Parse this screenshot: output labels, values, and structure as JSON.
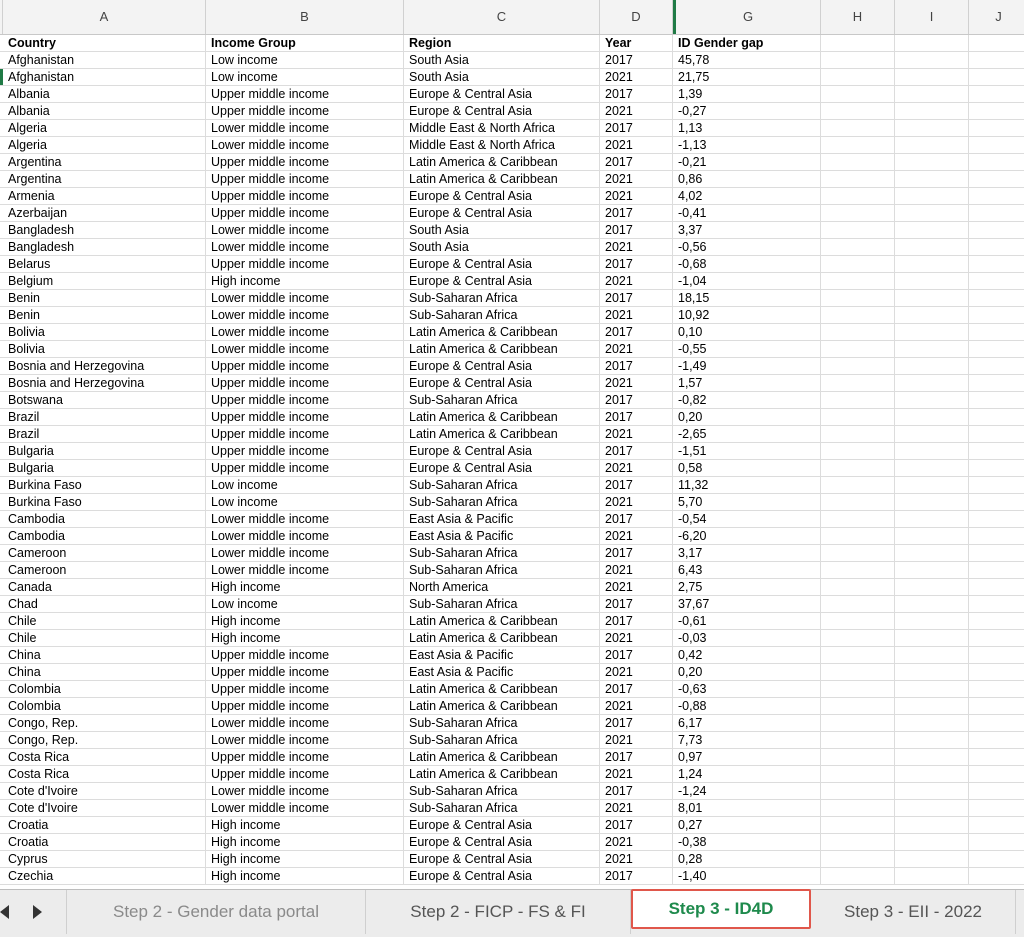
{
  "columns": [
    "A",
    "B",
    "C",
    "D",
    "G",
    "H",
    "I",
    "J"
  ],
  "header": [
    "Country",
    "Income Group",
    "Region",
    "Year",
    "ID Gender gap"
  ],
  "rows": [
    [
      "Afghanistan",
      "Low income",
      "South Asia",
      "2017",
      "45,78"
    ],
    [
      "Afghanistan",
      "Low income",
      "South Asia",
      "2021",
      "21,75"
    ],
    [
      "Albania",
      "Upper middle income",
      "Europe & Central Asia",
      "2017",
      "1,39"
    ],
    [
      "Albania",
      "Upper middle income",
      "Europe & Central Asia",
      "2021",
      "-0,27"
    ],
    [
      "Algeria",
      "Lower middle income",
      "Middle East & North Africa",
      "2017",
      "1,13"
    ],
    [
      "Algeria",
      "Lower middle income",
      "Middle East & North Africa",
      "2021",
      "-1,13"
    ],
    [
      "Argentina",
      "Upper middle income",
      "Latin America & Caribbean",
      "2017",
      "-0,21"
    ],
    [
      "Argentina",
      "Upper middle income",
      "Latin America & Caribbean",
      "2021",
      "0,86"
    ],
    [
      "Armenia",
      "Upper middle income",
      "Europe & Central Asia",
      "2021",
      "4,02"
    ],
    [
      "Azerbaijan",
      "Upper middle income",
      "Europe & Central Asia",
      "2017",
      "-0,41"
    ],
    [
      "Bangladesh",
      "Lower middle income",
      "South Asia",
      "2017",
      "3,37"
    ],
    [
      "Bangladesh",
      "Lower middle income",
      "South Asia",
      "2021",
      "-0,56"
    ],
    [
      "Belarus",
      "Upper middle income",
      "Europe & Central Asia",
      "2017",
      "-0,68"
    ],
    [
      "Belgium",
      "High income",
      "Europe & Central Asia",
      "2021",
      "-1,04"
    ],
    [
      "Benin",
      "Lower middle income",
      "Sub-Saharan Africa",
      "2017",
      "18,15"
    ],
    [
      "Benin",
      "Lower middle income",
      "Sub-Saharan Africa",
      "2021",
      "10,92"
    ],
    [
      "Bolivia",
      "Lower middle income",
      "Latin America & Caribbean",
      "2017",
      "0,10"
    ],
    [
      "Bolivia",
      "Lower middle income",
      "Latin America & Caribbean",
      "2021",
      "-0,55"
    ],
    [
      "Bosnia and Herzegovina",
      "Upper middle income",
      "Europe & Central Asia",
      "2017",
      "-1,49"
    ],
    [
      "Bosnia and Herzegovina",
      "Upper middle income",
      "Europe & Central Asia",
      "2021",
      "1,57"
    ],
    [
      "Botswana",
      "Upper middle income",
      "Sub-Saharan Africa",
      "2017",
      "-0,82"
    ],
    [
      "Brazil",
      "Upper middle income",
      "Latin America & Caribbean",
      "2017",
      "0,20"
    ],
    [
      "Brazil",
      "Upper middle income",
      "Latin America & Caribbean",
      "2021",
      "-2,65"
    ],
    [
      "Bulgaria",
      "Upper middle income",
      "Europe & Central Asia",
      "2017",
      "-1,51"
    ],
    [
      "Bulgaria",
      "Upper middle income",
      "Europe & Central Asia",
      "2021",
      "0,58"
    ],
    [
      "Burkina Faso",
      "Low income",
      "Sub-Saharan Africa",
      "2017",
      "11,32"
    ],
    [
      "Burkina Faso",
      "Low income",
      "Sub-Saharan Africa",
      "2021",
      "5,70"
    ],
    [
      "Cambodia",
      "Lower middle income",
      "East Asia & Pacific",
      "2017",
      "-0,54"
    ],
    [
      "Cambodia",
      "Lower middle income",
      "East Asia & Pacific",
      "2021",
      "-6,20"
    ],
    [
      "Cameroon",
      "Lower middle income",
      "Sub-Saharan Africa",
      "2017",
      "3,17"
    ],
    [
      "Cameroon",
      "Lower middle income",
      "Sub-Saharan Africa",
      "2021",
      "6,43"
    ],
    [
      "Canada",
      "High income",
      "North America",
      "2021",
      "2,75"
    ],
    [
      "Chad",
      "Low income",
      "Sub-Saharan Africa",
      "2017",
      "37,67"
    ],
    [
      "Chile",
      "High income",
      "Latin America & Caribbean",
      "2017",
      "-0,61"
    ],
    [
      "Chile",
      "High income",
      "Latin America & Caribbean",
      "2021",
      "-0,03"
    ],
    [
      "China",
      "Upper middle income",
      "East Asia & Pacific",
      "2017",
      "0,42"
    ],
    [
      "China",
      "Upper middle income",
      "East Asia & Pacific",
      "2021",
      "0,20"
    ],
    [
      "Colombia",
      "Upper middle income",
      "Latin America & Caribbean",
      "2017",
      "-0,63"
    ],
    [
      "Colombia",
      "Upper middle income",
      "Latin America & Caribbean",
      "2021",
      "-0,88"
    ],
    [
      "Congo, Rep.",
      "Lower middle income",
      "Sub-Saharan Africa",
      "2017",
      "6,17"
    ],
    [
      "Congo, Rep.",
      "Lower middle income",
      "Sub-Saharan Africa",
      "2021",
      "7,73"
    ],
    [
      "Costa Rica",
      "Upper middle income",
      "Latin America & Caribbean",
      "2017",
      "0,97"
    ],
    [
      "Costa Rica",
      "Upper middle income",
      "Latin America & Caribbean",
      "2021",
      "1,24"
    ],
    [
      "Cote d'Ivoire",
      "Lower middle income",
      "Sub-Saharan Africa",
      "2017",
      "-1,24"
    ],
    [
      "Cote d'Ivoire",
      "Lower middle income",
      "Sub-Saharan Africa",
      "2021",
      "8,01"
    ],
    [
      "Croatia",
      "High income",
      "Europe & Central Asia",
      "2017",
      "0,27"
    ],
    [
      "Croatia",
      "High income",
      "Europe & Central Asia",
      "2021",
      "-0,38"
    ],
    [
      "Cyprus",
      "High income",
      "Europe & Central Asia",
      "2021",
      "0,28"
    ],
    [
      "Czechia",
      "High income",
      "Europe & Central Asia",
      "2017",
      "-1,40"
    ]
  ],
  "tabs": [
    {
      "label": "Step 2 - Gender data portal",
      "state": "inactive"
    },
    {
      "label": "Step 2 - FICP - FS & FI",
      "state": "normal"
    },
    {
      "label": "Step 3 - ID4D",
      "state": "active"
    },
    {
      "label": "Step 3 - EII - 2022",
      "state": "normal"
    }
  ],
  "icons": {
    "prev": "triangle-left-icon",
    "next": "triangle-right-icon"
  },
  "colors": {
    "active_tab_text": "#1e8a4c",
    "active_tab_border": "#e0574b"
  }
}
